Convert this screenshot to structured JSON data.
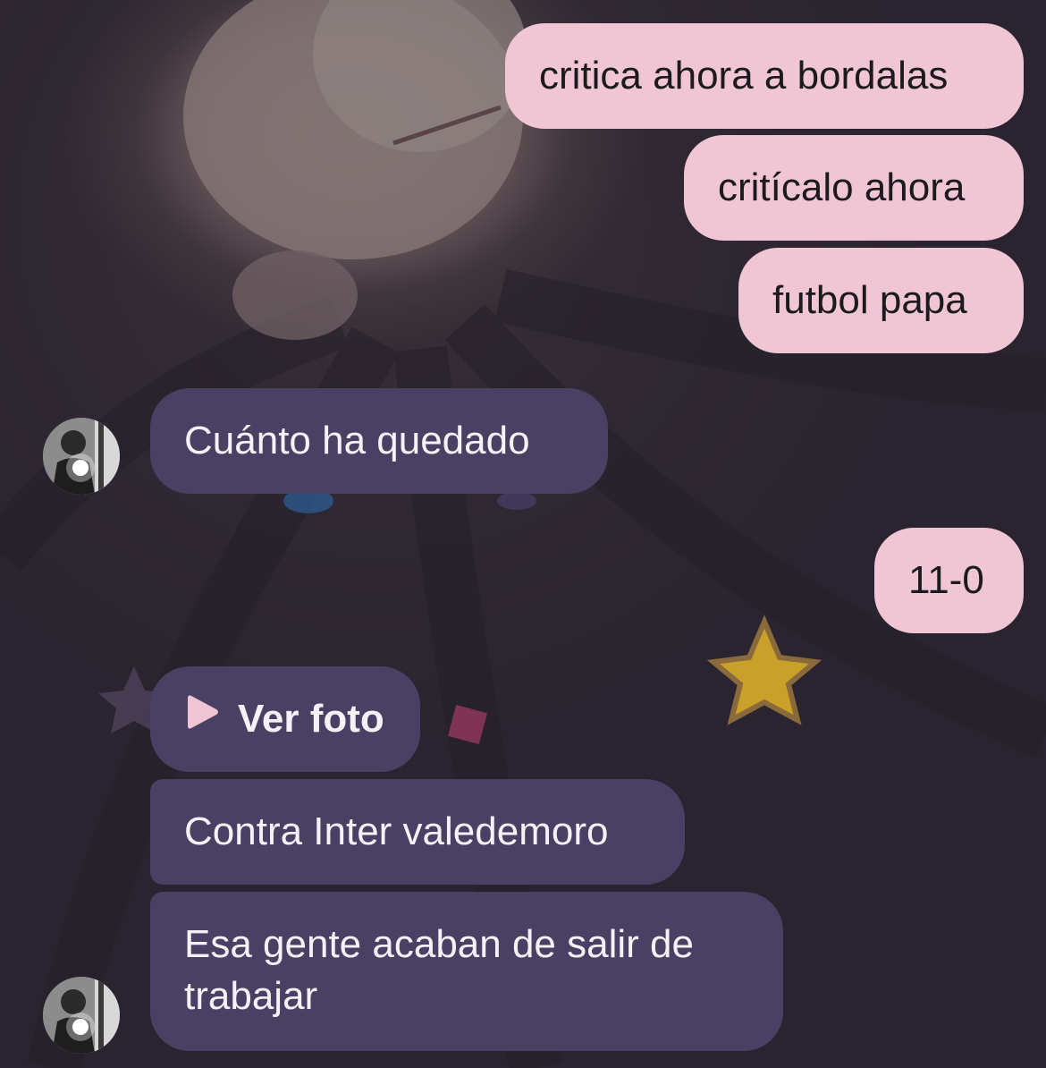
{
  "messages": {
    "outgoing": [
      {
        "text": "critica ahora a bordalas"
      },
      {
        "text": "critícalo ahora"
      },
      {
        "text": "futbol papa"
      },
      {
        "text": "11-0"
      }
    ],
    "incoming": [
      {
        "text": "Cuánto  ha quedado"
      },
      {
        "text": "Ver foto",
        "icon": "play-icon"
      },
      {
        "text": "Contra Inter valedemoro"
      },
      {
        "line1": "Esa gente acaban de salir de",
        "line2": "trabajar"
      }
    ]
  },
  "colors": {
    "outgoing_bubble": "#f1c6d4",
    "incoming_bubble": "#4a4063",
    "background": "#2b2530"
  }
}
